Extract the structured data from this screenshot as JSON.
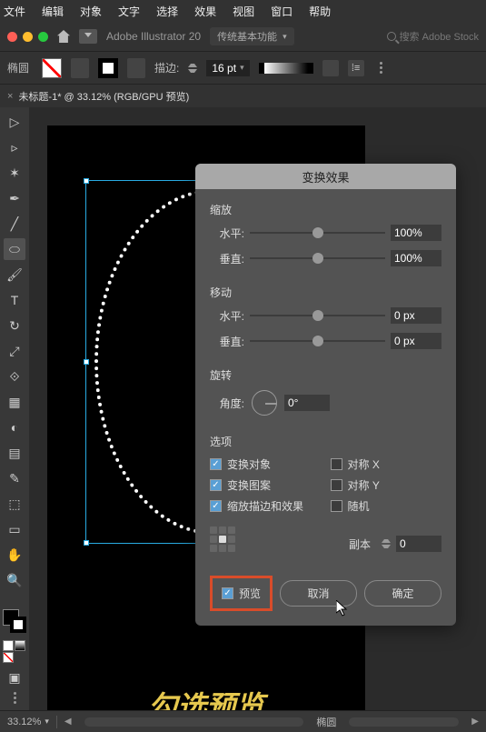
{
  "menu": {
    "file": "文件",
    "edit": "编辑",
    "object": "对象",
    "type": "文字",
    "select": "选择",
    "effect": "效果",
    "view": "视图",
    "window": "窗口",
    "help": "帮助"
  },
  "app": {
    "name": "Adobe Illustrator 20",
    "workspace": "传统基本功能",
    "search_ph": "搜索 Adobe Stock"
  },
  "control": {
    "shape_label": "椭圆",
    "stroke_label": "描边:",
    "stroke_value": "16 pt"
  },
  "tab": {
    "name": "未标题-1* @ 33.12% (RGB/GPU 预览)"
  },
  "dialog": {
    "title": "变换效果",
    "sections": {
      "scale": "缩放",
      "move": "移动",
      "rotate": "旋转",
      "options": "选项"
    },
    "labels": {
      "horizontal": "水平:",
      "vertical": "垂直:",
      "angle": "角度:",
      "copies": "副本"
    },
    "values": {
      "scale_h": "100%",
      "scale_v": "100%",
      "move_h": "0 px",
      "move_v": "0 px",
      "angle": "0°",
      "copies": "0"
    },
    "opts": {
      "transform_objects": "变换对象",
      "transform_patterns": "变换图案",
      "scale_strokes": "缩放描边和效果",
      "reflect_x": "对称 X",
      "reflect_y": "对称 Y",
      "random": "随机"
    },
    "preview": "预览",
    "cancel": "取消",
    "ok": "确定"
  },
  "status": {
    "zoom": "33.12%",
    "selection": "椭圆"
  },
  "caption": "勾选预览"
}
